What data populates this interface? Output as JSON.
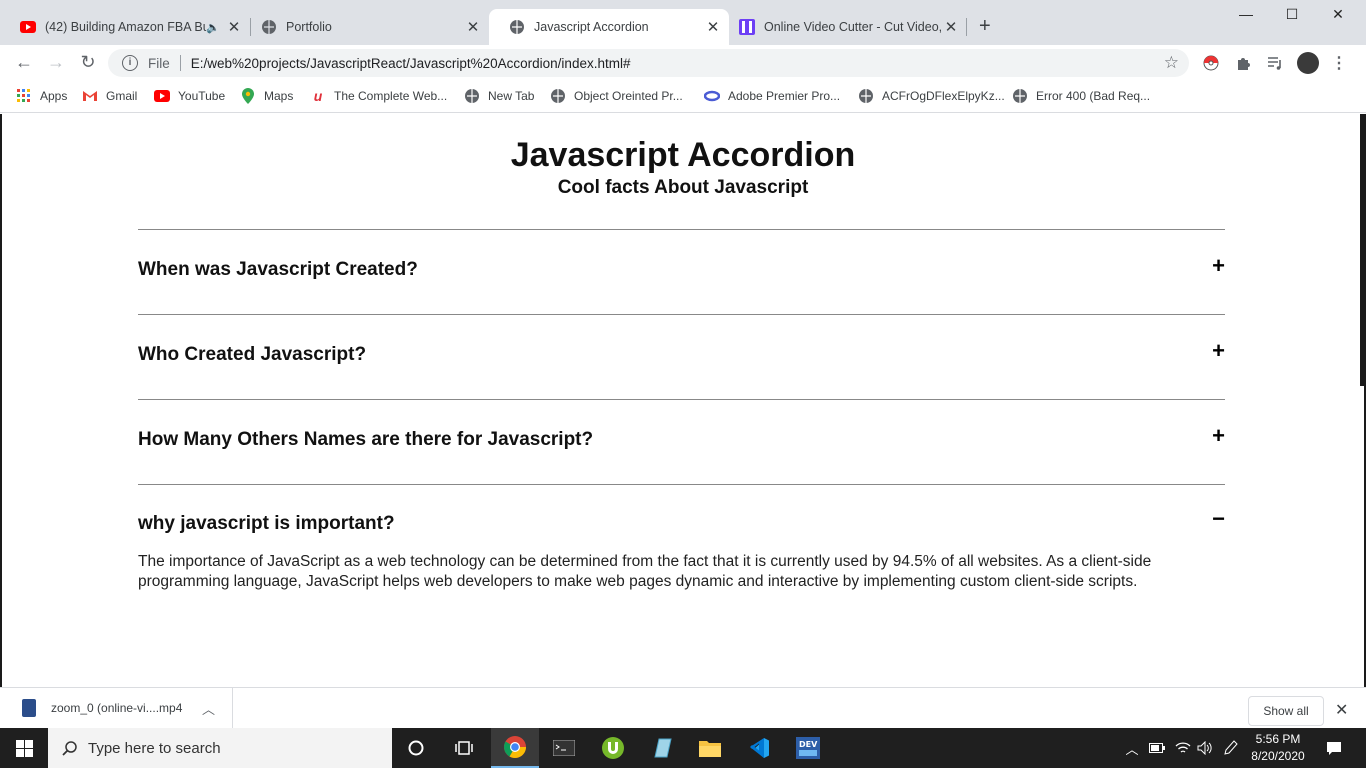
{
  "browser": {
    "tabs": [
      {
        "title": "(42) Building Amazon FBA Bu",
        "icon": "youtube-icon",
        "audio": "speaker-icon"
      },
      {
        "title": "Portfolio",
        "icon": "globe-icon"
      },
      {
        "title": "Javascript Accordion",
        "icon": "globe-icon",
        "active": true
      },
      {
        "title": "Online Video Cutter - Cut Video,",
        "icon": "video-cutter-icon"
      }
    ],
    "new_tab": "+",
    "window": {
      "minimize": "—",
      "maximize": "☐",
      "close": "✕"
    },
    "address": {
      "scheme_label": "File",
      "url": "E:/web%20projects/JavascriptReact/Javascript%20Accordion/index.html#"
    },
    "bookmarks": [
      {
        "label": "Apps",
        "icon": "apps-grid-icon"
      },
      {
        "label": "Gmail",
        "icon": "gmail-icon"
      },
      {
        "label": "YouTube",
        "icon": "youtube-icon"
      },
      {
        "label": "Maps",
        "icon": "maps-pin-icon"
      },
      {
        "label": "The Complete Web...",
        "icon": "udemy-icon"
      },
      {
        "label": "New Tab",
        "icon": "globe-icon"
      },
      {
        "label": "Object Oreinted Pr...",
        "icon": "globe-icon"
      },
      {
        "label": "Adobe Premier Pro...",
        "icon": "adobe-icon"
      },
      {
        "label": "ACFrOgDFlexElpyKz...",
        "icon": "globe-icon"
      },
      {
        "label": "Error 400 (Bad Req...",
        "icon": "globe-icon"
      }
    ]
  },
  "page": {
    "title": "Javascript Accordion",
    "subtitle": "Cool facts About Javascript",
    "accordion": [
      {
        "question": "When was Javascript Created?",
        "toggle": "+"
      },
      {
        "question": "Who Created Javascript?",
        "toggle": "+"
      },
      {
        "question": "How Many Others Names are there for Javascript?",
        "toggle": "+"
      },
      {
        "question": "why javascript is important?",
        "toggle": "−",
        "answer": "The importance of JavaScript as a web technology can be determined from the fact that it is currently used by 94.5% of all websites. As a client-side programming language, JavaScript helps web developers to make web pages dynamic and interactive by implementing custom client-side scripts."
      }
    ]
  },
  "downloads": {
    "file": "zoom_0 (online-vi....mp4",
    "show_all": "Show all"
  },
  "taskbar": {
    "search_placeholder": "Type here to search",
    "time": "5:56 PM",
    "date": "8/20/2020"
  }
}
